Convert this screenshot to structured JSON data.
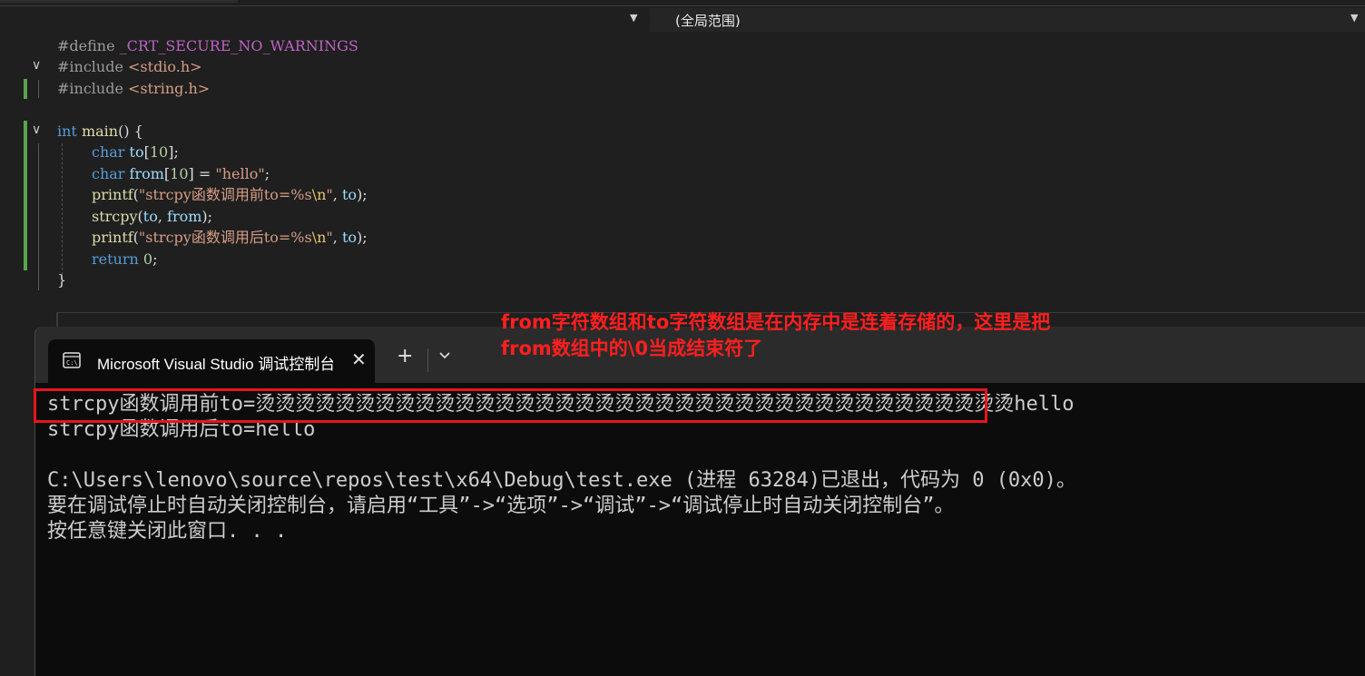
{
  "nav": {
    "scope": "(全局范围)"
  },
  "code": {
    "l1": {
      "pp": "#define",
      "macro": "_CRT_SECURE_NO_WARNINGS"
    },
    "l2": {
      "pp": "#include",
      "hdr": "<stdio.h>"
    },
    "l3": {
      "pp": "#include",
      "hdr": "<string.h>"
    },
    "l5": {
      "kw": "int",
      "fn": "main",
      "rest": "() {"
    },
    "l6": {
      "kw": "char",
      "var": "to",
      "o": "[",
      "num": "10",
      "c": "];"
    },
    "l7": {
      "kw": "char",
      "var": "from",
      "o": "[",
      "num": "10",
      "m": "] = ",
      "str": "\"hello\"",
      "c": ";"
    },
    "l8": {
      "fn": "printf",
      "o": "(",
      "str1": "\"strcpy函数调用前to=%s",
      "esc": "\\n",
      "str2": "\"",
      "m": ", ",
      "var": "to",
      "c": ");"
    },
    "l9": {
      "fn": "strcpy",
      "o": "(",
      "var1": "to",
      "m": ", ",
      "var2": "from",
      "c": ");"
    },
    "l10": {
      "fn": "printf",
      "o": "(",
      "str1": "\"strcpy函数调用后to=%s",
      "esc": "\\n",
      "str2": "\"",
      "m": ", ",
      "var": "to",
      "c": ");"
    },
    "l11": {
      "kw": "return",
      "num": "0",
      "c": ";"
    },
    "l12": "}"
  },
  "terminal": {
    "tab_title": "Microsoft Visual Studio 调试控制台",
    "new_tab": "+",
    "lines": [
      "strcpy函数调用前to=烫烫烫烫烫烫烫烫烫烫烫烫烫烫烫烫烫烫烫烫烫烫烫烫烫烫烫烫烫烫烫烫烫烫烫烫烫烫hello",
      "strcpy函数调用后to=hello",
      "C:\\Users\\lenovo\\source\\repos\\test\\x64\\Debug\\test.exe (进程 63284)已退出，代码为 0 (0x0)。",
      "要在调试停止时自动关闭控制台，请启用“工具”->“选项”->“调试”->“调试停止时自动关闭控制台”。",
      "按任意键关闭此窗口. . ."
    ]
  },
  "annotation": {
    "line1": "from字符数组和to字符数组是在内存中是连着存储的，这里是把",
    "line2": "from数组中的\\0当成结束符了"
  },
  "colors": {
    "highlight": "#e8141c",
    "annotation": "#ff1f1f",
    "gutter_change": "#57a64a"
  }
}
